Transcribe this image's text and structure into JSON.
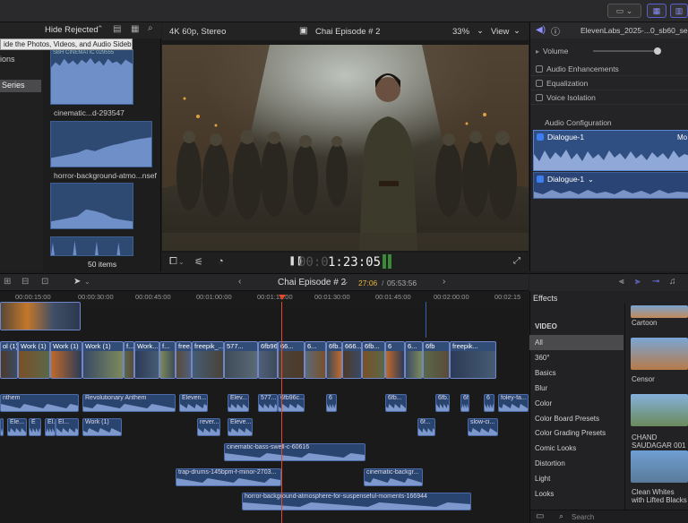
{
  "topbar": {
    "icons": [
      "display-icon",
      "grid-icon",
      "panels-icon"
    ]
  },
  "browser": {
    "filter": "Hide Rejected",
    "tooltip": "ide the Photos, Videos, and Audio Sidebar",
    "sidebar_items": [
      "ions",
      "Series"
    ],
    "clips": [
      {
        "label": "cinematic...d-293547"
      },
      {
        "label": "horror-background-atmo...nsef"
      }
    ],
    "top_clip_text": "SBH CINEMATIC 029555",
    "count": "50 items"
  },
  "viewer": {
    "format": "4K 60p, Stereo",
    "title": "Chai Episode # 2",
    "zoom": "33%",
    "view": "View",
    "timecode_dim": "00:0",
    "timecode": "1:23:05"
  },
  "inspector": {
    "file": "ElevenLabs_2025-...0_sb60_se51",
    "volume": "Volume",
    "enhancements": "Audio Enhancements",
    "equalization": "Equalization",
    "voice_isolation": "Voice Isolation",
    "config": "Audio Configuration",
    "channel1": "Dialogue-1",
    "channel1_extra": "Mo",
    "channel2": "Dialogue-1"
  },
  "timeline": {
    "project": "Chai Episode # 2",
    "position": "27:06",
    "duration": "05:53:56",
    "ruler": [
      "00:00:15:00",
      "00:00:30:00",
      "00:00:45:00",
      "00:01:00:00",
      "00:01:15:00",
      "00:01:30:00",
      "00:01:45:00",
      "00:02:00:00",
      "00:02:15"
    ],
    "video_clips": [
      {
        "label": "ol (1)"
      },
      {
        "label": "Work (1)"
      },
      {
        "label": "Work (1)"
      },
      {
        "label": "Work (1)"
      },
      {
        "label": "f..."
      },
      {
        "label": "Work..."
      },
      {
        "label": "f..."
      },
      {
        "label": "free..."
      },
      {
        "label": "freepik_..."
      },
      {
        "label": "577..."
      },
      {
        "label": "6fb96c..."
      },
      {
        "label": "66..."
      },
      {
        "label": "6..."
      },
      {
        "label": "6fb..."
      },
      {
        "label": "666..."
      },
      {
        "label": "6fb..."
      },
      {
        "label": "6"
      },
      {
        "label": "6..."
      },
      {
        "label": "6fb"
      },
      {
        "label": "freepik..."
      }
    ],
    "audio_row1": [
      {
        "label": "nthem"
      },
      {
        "label": "Revolutionary Anthem"
      },
      {
        "label": "Eleven..."
      },
      {
        "label": "Elev..."
      },
      {
        "label": "577..."
      },
      {
        "label": "6fb96c..."
      },
      {
        "label": "6"
      },
      {
        "label": "6fb..."
      },
      {
        "label": "6fb..."
      },
      {
        "label": "6fb"
      },
      {
        "label": "6"
      },
      {
        "label": "foley-fa..."
      }
    ],
    "audio_row2": [
      {
        "label": "Ele..."
      },
      {
        "label": "Ele..."
      },
      {
        "label": "E"
      },
      {
        "label": "El..."
      },
      {
        "label": "El..."
      },
      {
        "label": "Work (1)"
      },
      {
        "label": "rever..."
      },
      {
        "label": "Eleve..."
      },
      {
        "label": "6f..."
      },
      {
        "label": "slow-ci..."
      }
    ],
    "audio_row3": [
      {
        "label": "cinematic-bass-swell-c-60616"
      }
    ],
    "audio_row4": [
      {
        "label": "trap-drums-145bpm-f-minor-2703..."
      },
      {
        "label": "cinematic-backgr..."
      }
    ],
    "audio_row5": [
      {
        "label": "horror-background-atmosphere-for-suspenseful-moments-166944"
      }
    ]
  },
  "effects": {
    "title": "Effects",
    "section": "VIDEO",
    "categories": [
      "All",
      "360°",
      "Basics",
      "Blur",
      "Color",
      "Color Board Presets",
      "Color Grading Presets",
      "Comic Looks",
      "Distortion",
      "Light",
      "Looks"
    ],
    "items": [
      "Cartoon",
      "Censor",
      "CHAND SAUDAGAR 001",
      "Clean Whites with Lifted Blacks"
    ],
    "search": "Search"
  }
}
